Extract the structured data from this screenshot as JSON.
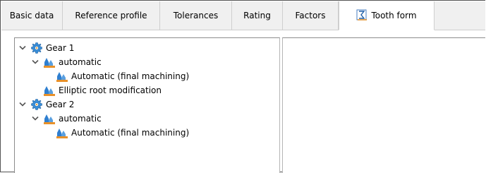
{
  "tabs": [
    {
      "label": "Basic data",
      "active": false
    },
    {
      "label": "Reference profile",
      "active": false
    },
    {
      "label": "Tolerances",
      "active": false
    },
    {
      "label": "Rating",
      "active": false
    },
    {
      "label": "Factors",
      "active": false
    },
    {
      "label": "Tooth form",
      "active": true,
      "icon": "sigma-sum-icon"
    }
  ],
  "tree": {
    "gear1": {
      "label": "Gear 1",
      "icon": "gear-icon",
      "expanded": true,
      "automatic": {
        "label": "automatic",
        "icon": "tooth-tool-icon",
        "expanded": true,
        "child_label": "Automatic (final machining)"
      },
      "elliptic": {
        "label": "Elliptic root modification",
        "icon": "tooth-tool-icon"
      }
    },
    "gear2": {
      "label": "Gear 2",
      "icon": "gear-icon",
      "expanded": true,
      "automatic": {
        "label": "automatic",
        "icon": "tooth-tool-icon",
        "expanded": true,
        "child_label": "Automatic (final machining)"
      }
    }
  },
  "colors": {
    "tab_bar": "#f0f0f0",
    "gear_icon": "#3a8fd8",
    "tool_icon_blue": "#2f7fd0",
    "tool_icon_orange": "#e8912a",
    "chevron": "#555555"
  }
}
